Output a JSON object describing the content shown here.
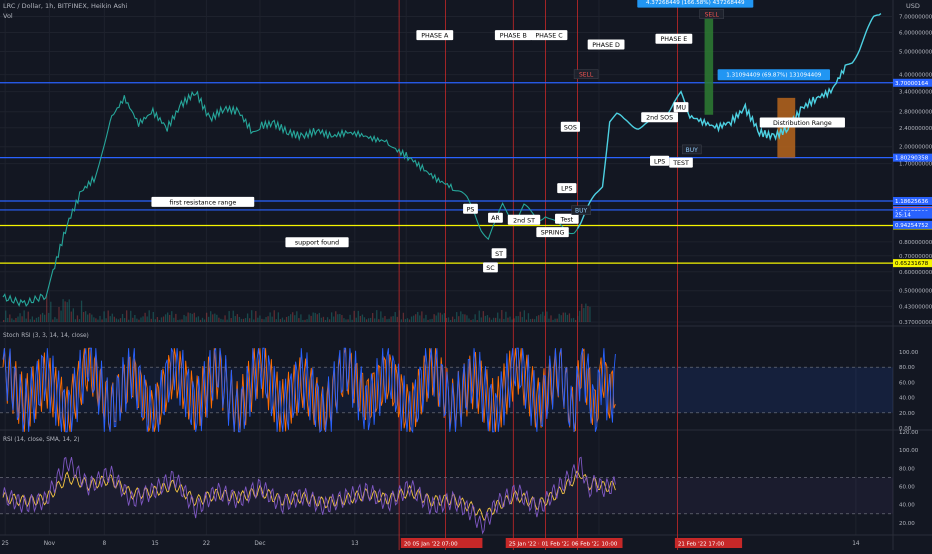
{
  "header": {
    "title": "LRC / Dollar, 1h, BITFINEX, Heikin Ashi",
    "vol_label": "Vol",
    "currency": "USD"
  },
  "colors": {
    "background": "#131722",
    "grid": "#1e222d",
    "up": "#26a69a",
    "down": "#ef5350",
    "blue_line": "#2962ff",
    "yellow_line": "#f5f500",
    "red_vline": "#c62828",
    "phase_line": "#4dd0e1",
    "stoch_k": "#2962ff",
    "stoch_d": "#ff6d00",
    "rsi": "#7e57c2",
    "rsi_ma": "#f5c542",
    "box_green": "#2e7d32",
    "box_orange": "#b7651c"
  },
  "chart_data": [
    {
      "type": "line",
      "pane": "price",
      "yscale": "log",
      "ylim": [
        0.37,
        7.6
      ],
      "price_ticks": [
        "7.00000000",
        "6.00000000",
        "5.00000000",
        "4.00000000",
        "3.40000000",
        "2.80000000",
        "2.40000000",
        "2.00000000",
        "1.70000000",
        "0.80000000",
        "0.70000000",
        "0.60000000",
        "0.50000000",
        "0.43000000",
        "0.37000000"
      ],
      "x_ticks": [
        "25",
        "Nov",
        "8",
        "15",
        "22",
        "Dec",
        "13",
        "20",
        "17",
        "14"
      ],
      "x_tick_pos": [
        0.3,
        6.5,
        14.2,
        21.3,
        28.5,
        36,
        49.3,
        56.5,
        83.5,
        119.5
      ],
      "series": [
        {
          "x": [
            0,
            3,
            6,
            7,
            9,
            11,
            13,
            14,
            15,
            17,
            19,
            21,
            23,
            25,
            27,
            29,
            31,
            33,
            35,
            36,
            38,
            40,
            42,
            44,
            46,
            48,
            50,
            52,
            54,
            55,
            57,
            59,
            61,
            63,
            64,
            65,
            66,
            67,
            68,
            69,
            70,
            71,
            72,
            73,
            74,
            75,
            76,
            77,
            78,
            79,
            80,
            81,
            82,
            83,
            84,
            85,
            86,
            87,
            88,
            89,
            90,
            91,
            92,
            93,
            94,
            95,
            96,
            98,
            100,
            102,
            104,
            106,
            108,
            110,
            112,
            114,
            116,
            118,
            119,
            120,
            121,
            122,
            123
          ],
          "values": [
            0.47,
            0.44,
            0.48,
            0.6,
            0.95,
            1.3,
            1.5,
            2.0,
            2.6,
            3.2,
            2.5,
            2.8,
            2.4,
            3.0,
            3.4,
            2.6,
            2.9,
            2.8,
            2.3,
            2.45,
            2.5,
            2.3,
            2.2,
            2.35,
            2.2,
            2.3,
            2.25,
            2.15,
            2.1,
            1.95,
            1.8,
            1.6,
            1.45,
            1.35,
            1.28,
            1.2,
            1.08,
            0.92,
            0.82,
            0.95,
            1.15,
            1.05,
            1.0,
            1.12,
            1.05,
            1.0,
            1.05,
            0.98,
            0.92,
            0.88,
            0.9,
            0.97,
            1.1,
            1.25,
            1.4,
            2.6,
            2.7,
            2.55,
            2.5,
            2.45,
            2.48,
            2.5,
            2.55,
            2.8,
            3.1,
            3.3,
            2.7,
            2.55,
            2.4,
            2.55,
            2.9,
            2.3,
            2.2,
            2.4,
            2.9,
            3.2,
            3.4,
            4.3,
            4.6,
            5.2,
            6.0,
            6.8,
            7.2
          ]
        }
      ],
      "hlines": [
        {
          "value": 3.7,
          "label": "3.70000164",
          "color": "#2962ff",
          "label_bg": "#2962ff"
        },
        {
          "value": 1.8,
          "label": "1.80290358",
          "color": "#2962ff",
          "label_bg": "#2962ff"
        },
        {
          "value": 1.186,
          "label": "1.18625636",
          "color": "#2962ff",
          "label_bg": "#2962ff"
        },
        {
          "value": 1.088,
          "label": "1.08814125",
          "color": "#2962ff",
          "label_bg": "#2962ff"
        },
        {
          "value": 0.937,
          "label": "0.93723905",
          "color": "#f5f500",
          "label_bg": "#f5f500"
        },
        {
          "value": 0.652,
          "label": "0.65231678",
          "color": "#f5f500",
          "label_bg": "#f5f500"
        }
      ],
      "tags": [
        {
          "value": 1.077,
          "label": "1.07740000",
          "bg": "#ef5350"
        },
        {
          "value": 1.069,
          "label": "1.06977500",
          "bg": "#2962ff"
        },
        {
          "value": 1.04,
          "label": "25:14",
          "bg": "#2962ff"
        },
        {
          "value": 0.942,
          "label": "0.94254752",
          "bg": "#2962ff"
        }
      ],
      "annotations": [
        {
          "text": "PHASE A",
          "x": 60.5,
          "value": 5.8
        },
        {
          "text": "PHASE B",
          "x": 71.5,
          "value": 5.8
        },
        {
          "text": "PHASE C",
          "x": 76.5,
          "value": 5.8
        },
        {
          "text": "PHASE D",
          "x": 84.5,
          "value": 5.3
        },
        {
          "text": "PHASE E",
          "x": 94,
          "value": 5.6
        },
        {
          "text": "first resistance range",
          "x": 28,
          "value": 1.165
        },
        {
          "text": "support found",
          "x": 44,
          "value": 0.79
        },
        {
          "text": "PS",
          "x": 65.5,
          "value": 1.09
        },
        {
          "text": "AR",
          "x": 69,
          "value": 1.0
        },
        {
          "text": "2nd ST",
          "x": 73,
          "value": 0.98
        },
        {
          "text": "ST",
          "x": 69.5,
          "value": 0.71
        },
        {
          "text": "SC",
          "x": 68.3,
          "value": 0.62
        },
        {
          "text": "SPRING",
          "x": 77,
          "value": 0.87
        },
        {
          "text": "Test",
          "x": 79,
          "value": 0.99
        },
        {
          "text": "LPS",
          "x": 79,
          "value": 1.33
        },
        {
          "text": "SOS",
          "x": 79.5,
          "value": 2.4
        },
        {
          "text": "2nd SOS",
          "x": 92,
          "value": 2.63
        },
        {
          "text": "MU",
          "x": 95,
          "value": 2.9
        },
        {
          "text": "LPS",
          "x": 92,
          "value": 1.73
        },
        {
          "text": "TEST",
          "x": 95,
          "value": 1.7
        },
        {
          "text": "Distribution Range",
          "x": 112,
          "value": 2.5
        }
      ],
      "signals": [
        {
          "text": "SELL",
          "x": 81.7,
          "value": 3.98,
          "color": "#ef5350"
        },
        {
          "text": "BUY",
          "x": 81,
          "value": 1.075,
          "color": "#90caf9"
        },
        {
          "text": "BUY",
          "x": 96.5,
          "value": 1.93,
          "color": "#90caf9"
        },
        {
          "text": "SELL",
          "x": 99.3,
          "value": 7.1,
          "color": "#ef5350"
        }
      ],
      "measures": [
        {
          "text": "4.37268449 (166.58%) 437268449",
          "x": 97,
          "value": 8.0
        },
        {
          "text": "1.31094409 (69.87%) 131094409",
          "x": 108,
          "value": 3.98
        }
      ],
      "boxes": [
        {
          "x0": 98.3,
          "x1": 99.5,
          "v0": 2.72,
          "v1": 7.15,
          "color": "#2e7d32"
        },
        {
          "x0": 108.5,
          "x1": 111,
          "v0": 1.8,
          "v1": 3.2,
          "color": "#b7651c"
        }
      ],
      "vlines": [
        55.5,
        62,
        71.5,
        76,
        80.5,
        94.5
      ],
      "date_badges": [
        {
          "text": "20  05 Jan '22  07:00",
          "x": 56.3
        },
        {
          "text": "25 Jan '22  02",
          "x": 71
        },
        {
          "text": "01 Feb '22  02",
          "x": 75.6
        },
        {
          "text": "06 Feb '22",
          "x": 79.8
        },
        {
          "text": "10:00",
          "x": 84
        },
        {
          "text": "21 Feb '22  17:00",
          "x": 94.7
        }
      ],
      "xlim": [
        0,
        124
      ]
    },
    {
      "type": "line",
      "pane": "stoch",
      "title": "Stoch RSI (3, 3, 14, 14, close)",
      "ylim": [
        0,
        100
      ],
      "ticks": [
        "100.00",
        "80.00",
        "60.00",
        "40.00",
        "20.00",
        "0.00"
      ],
      "tick_values": [
        100,
        80,
        60,
        40,
        20,
        0
      ],
      "bands": [
        80,
        20
      ],
      "series": [
        {
          "name": "K",
          "x": [
            0,
            3,
            6,
            9,
            12,
            15,
            18,
            21,
            24,
            27,
            30,
            33,
            36,
            39,
            42,
            45,
            48,
            51,
            54,
            57,
            60,
            63,
            66,
            69,
            72,
            75,
            78,
            80,
            81,
            82,
            83,
            84,
            85,
            86
          ],
          "values": [
            90,
            20,
            75,
            10,
            95,
            15,
            80,
            5,
            90,
            20,
            85,
            10,
            95,
            15,
            70,
            10,
            90,
            25,
            80,
            8,
            92,
            18,
            75,
            12,
            95,
            20,
            88,
            5,
            95,
            60,
            10,
            85,
            30,
            70
          ]
        },
        {
          "name": "D",
          "x": [
            0,
            3,
            6,
            9,
            12,
            15,
            18,
            21,
            24,
            27,
            30,
            33,
            36,
            39,
            42,
            45,
            48,
            51,
            54,
            57,
            60,
            63,
            66,
            69,
            72,
            75,
            78,
            80,
            81,
            82,
            83,
            84,
            85,
            86
          ],
          "values": [
            80,
            30,
            65,
            20,
            85,
            25,
            70,
            15,
            80,
            30,
            75,
            20,
            85,
            25,
            62,
            18,
            80,
            35,
            70,
            18,
            82,
            28,
            65,
            22,
            85,
            30,
            78,
            15,
            85,
            55,
            20,
            75,
            40,
            62
          ]
        }
      ]
    },
    {
      "type": "line",
      "pane": "rsi",
      "title": "RSI (14, close, SMA, 14, 2)",
      "ylim": [
        10,
        120
      ],
      "ticks": [
        "120.00",
        "100.00",
        "80.00",
        "60.00",
        "40.00",
        "20.00"
      ],
      "tick_values": [
        120,
        100,
        80,
        60,
        40,
        20
      ],
      "bands": [
        70,
        30
      ],
      "series": [
        {
          "name": "RSI",
          "x": [
            0,
            3,
            6,
            9,
            12,
            15,
            18,
            21,
            24,
            27,
            30,
            33,
            36,
            39,
            42,
            45,
            48,
            51,
            54,
            57,
            60,
            63,
            66,
            67,
            68,
            69,
            72,
            75,
            78,
            80,
            81,
            82,
            83,
            84,
            85,
            86
          ],
          "values": [
            50,
            40,
            45,
            88,
            60,
            75,
            45,
            55,
            70,
            35,
            55,
            45,
            60,
            40,
            50,
            38,
            48,
            55,
            42,
            60,
            38,
            45,
            30,
            15,
            25,
            40,
            55,
            35,
            60,
            75,
            85,
            55,
            65,
            58,
            60,
            62
          ]
        },
        {
          "name": "RSI MA",
          "x": [
            0,
            3,
            6,
            9,
            12,
            15,
            18,
            21,
            24,
            27,
            30,
            33,
            36,
            39,
            42,
            45,
            48,
            51,
            54,
            57,
            60,
            63,
            66,
            67,
            68,
            69,
            72,
            75,
            78,
            80,
            81,
            82,
            83,
            84,
            85,
            86
          ],
          "values": [
            48,
            44,
            46,
            70,
            62,
            68,
            52,
            54,
            62,
            44,
            52,
            48,
            55,
            45,
            48,
            42,
            46,
            52,
            46,
            55,
            44,
            46,
            36,
            28,
            30,
            38,
            50,
            40,
            54,
            68,
            75,
            62,
            64,
            60,
            60,
            61
          ]
        }
      ]
    }
  ]
}
